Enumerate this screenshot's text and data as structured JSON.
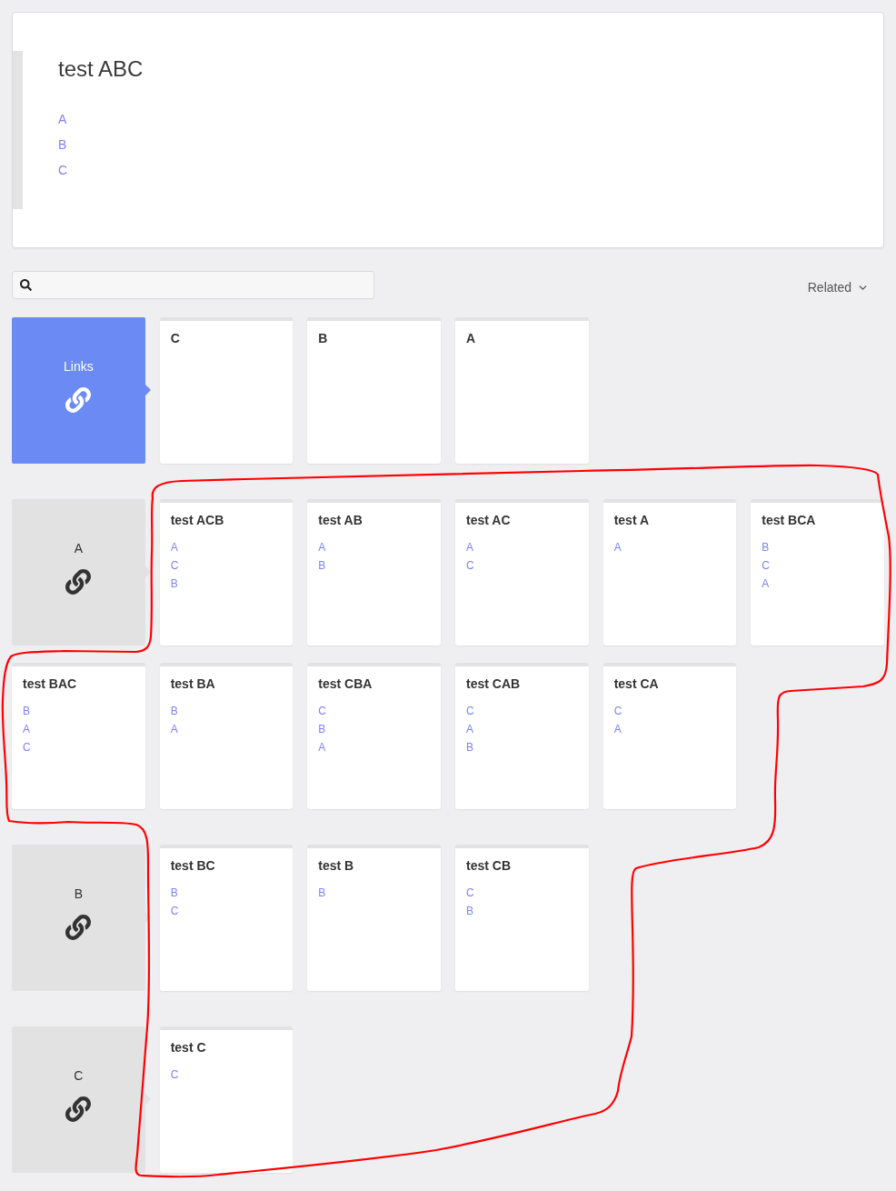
{
  "header": {
    "title": "test ABC",
    "links": [
      "A",
      "B",
      "C"
    ]
  },
  "sort_menu": {
    "label": "Related"
  },
  "groups": [
    {
      "label": "Links",
      "selected": true,
      "cards": [
        {
          "title": "C"
        },
        {
          "title": "B"
        },
        {
          "title": "A"
        }
      ]
    },
    {
      "label": "A",
      "selected": false,
      "cards": [
        {
          "title": "test ACB",
          "links": [
            "A",
            "C",
            "B"
          ]
        },
        {
          "title": "test AB",
          "links": [
            "A",
            "B"
          ]
        },
        {
          "title": "test AC",
          "links": [
            "A",
            "C"
          ]
        },
        {
          "title": "test A",
          "links": [
            "A"
          ]
        },
        {
          "title": "test BCA",
          "links": [
            "B",
            "C",
            "A"
          ]
        },
        {
          "title": "test BAC",
          "links": [
            "B",
            "A",
            "C"
          ]
        },
        {
          "title": "test BA",
          "links": [
            "B",
            "A"
          ]
        },
        {
          "title": "test CBA",
          "links": [
            "C",
            "B",
            "A"
          ]
        },
        {
          "title": "test CAB",
          "links": [
            "C",
            "A",
            "B"
          ]
        },
        {
          "title": "test CA",
          "links": [
            "C",
            "A"
          ]
        }
      ]
    },
    {
      "label": "B",
      "selected": false,
      "cards": [
        {
          "title": "test BC",
          "links": [
            "B",
            "C"
          ]
        },
        {
          "title": "test B",
          "links": [
            "B"
          ]
        },
        {
          "title": "test CB",
          "links": [
            "C",
            "B"
          ]
        }
      ]
    },
    {
      "label": "C",
      "selected": false,
      "cards": [
        {
          "title": "test C",
          "links": [
            "C"
          ]
        }
      ]
    }
  ],
  "annotation": {
    "kind": "freehand_outline"
  }
}
